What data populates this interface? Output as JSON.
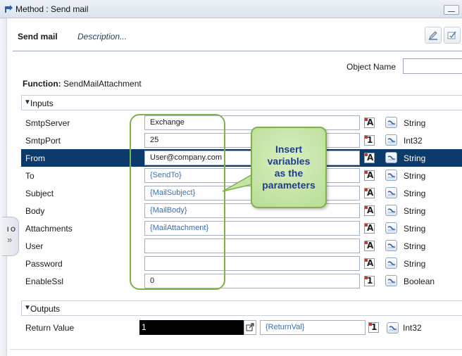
{
  "window": {
    "title": "Method : Send mail"
  },
  "tabs": {
    "send_mail": "Send mail",
    "description": "Description..."
  },
  "io_tab": {
    "label": "I O"
  },
  "object_name": {
    "label": "Object Name",
    "value": ""
  },
  "function": {
    "label": "Function:",
    "name": "SendMailAttachment"
  },
  "inputs_section": {
    "title": "Inputs"
  },
  "outputs_section": {
    "title": "Outputs"
  },
  "inputs": [
    {
      "label": "SmtpServer",
      "value": "Exchange",
      "is_variable": false,
      "type_badge": "A",
      "type": "String"
    },
    {
      "label": "SmtpPort",
      "value": "25",
      "is_variable": false,
      "type_badge": "1",
      "type": "Int32"
    },
    {
      "label": "From",
      "value": "User@company.com",
      "is_variable": false,
      "type_badge": "A",
      "type": "String",
      "selected": true
    },
    {
      "label": "To",
      "value": "{SendTo}",
      "is_variable": true,
      "type_badge": "A",
      "type": "String"
    },
    {
      "label": "Subject",
      "value": "{MailSubject}",
      "is_variable": true,
      "type_badge": "A",
      "type": "String"
    },
    {
      "label": "Body",
      "value": "{MailBody}",
      "is_variable": true,
      "type_badge": "A",
      "type": "String"
    },
    {
      "label": "Attachments",
      "value": "{MailAttachment}",
      "is_variable": true,
      "type_badge": "A",
      "type": "String"
    },
    {
      "label": "User",
      "value": "",
      "is_variable": false,
      "type_badge": "A",
      "type": "String"
    },
    {
      "label": "Password",
      "value": "",
      "is_variable": false,
      "type_badge": "A",
      "type": "String"
    },
    {
      "label": "EnableSsl",
      "value": "0",
      "is_variable": false,
      "type_badge": "1",
      "type": "Boolean"
    }
  ],
  "outputs": {
    "label": "Return Value",
    "value": "1",
    "variable": "{ReturnVal}",
    "type_badge": "1",
    "type": "Int32"
  },
  "callout": {
    "line1": "Insert",
    "line2": "variables",
    "line3": "as the",
    "line4": "parameters"
  },
  "colors": {
    "selected_row": "#0c3a6b",
    "callout_border": "#7fb24a",
    "callout_text": "#1e3d8f",
    "variable_text": "#3b6fb0"
  }
}
